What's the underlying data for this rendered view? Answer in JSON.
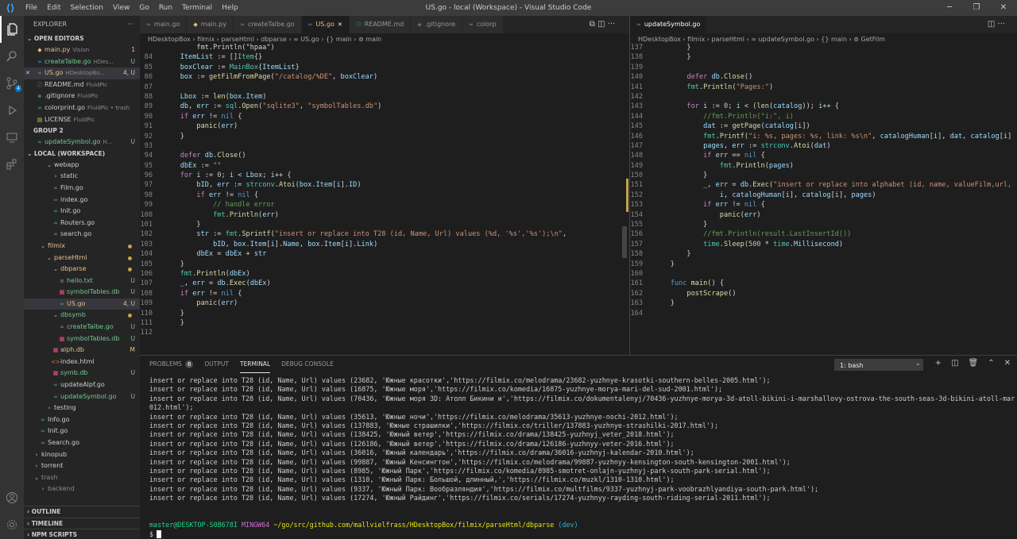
{
  "titlebar": {
    "menu": [
      "File",
      "Edit",
      "Selection",
      "View",
      "Go",
      "Run",
      "Terminal",
      "Help"
    ],
    "title": "US.go - local (Workspace) - Visual Studio Code",
    "win_min": "─",
    "win_max": "❐",
    "win_close": "✕"
  },
  "activity_icons": [
    "files-icon",
    "search-icon",
    "source-control-icon",
    "run-debug-icon",
    "remote-explorer-icon",
    "extensions-icon",
    "account-icon",
    "settings-gear-icon"
  ],
  "sidebar": {
    "header": "EXPLORER",
    "more": "···",
    "open_editors": "OPEN EDITORS",
    "open_editors_items": [
      {
        "icon": "py",
        "name": "main.py",
        "sub": "Vision",
        "badge": "1",
        "color": "#e2c08d"
      },
      {
        "icon": "go",
        "name": "createTalbe.go",
        "sub": "HDes...",
        "badge": "U",
        "color": "#73c991"
      },
      {
        "icon": "go",
        "name": "US.go",
        "sub": "HDesktopBo...",
        "badge": "4, U",
        "color": "#e2c08d",
        "close": "✕",
        "sel": true
      },
      {
        "icon": "md",
        "name": "README.md",
        "sub": "FluidPic",
        "badge": "",
        "color": "#cccccc"
      },
      {
        "icon": "git",
        "name": ".gitignore",
        "sub": "FluidPic",
        "badge": "",
        "color": "#cccccc"
      },
      {
        "icon": "go",
        "name": "colorprint.go",
        "sub": "FluidPic • trash",
        "badge": "",
        "color": "#cccccc"
      },
      {
        "icon": "lic",
        "name": "LICENSE",
        "sub": "FluidPic",
        "badge": "",
        "color": "#cccccc"
      }
    ],
    "group2": "GROUP 2",
    "group2_items": [
      {
        "icon": "go",
        "name": "updateSymbol.go",
        "sub": "H...",
        "badge": "U",
        "color": "#73c991"
      }
    ],
    "workspace": "LOCAL (WORKSPACE)",
    "tree": [
      {
        "indent": 2,
        "arrow": "⌄",
        "name": "webapp",
        "color": "#cccccc",
        "badge": ""
      },
      {
        "indent": 3,
        "arrow": "›",
        "name": "static",
        "color": "#cccccc",
        "badge": ""
      },
      {
        "indent": 3,
        "icon": "go",
        "name": "Film.go",
        "color": "#cccccc",
        "badge": ""
      },
      {
        "indent": 3,
        "icon": "go",
        "name": "index.go",
        "color": "#cccccc",
        "badge": ""
      },
      {
        "indent": 3,
        "icon": "go",
        "name": "Init.go",
        "color": "#cccccc",
        "badge": ""
      },
      {
        "indent": 3,
        "icon": "go",
        "name": "Routers.go",
        "color": "#cccccc",
        "badge": ""
      },
      {
        "indent": 3,
        "icon": "go",
        "name": "search.go",
        "color": "#cccccc",
        "badge": ""
      },
      {
        "indent": 1,
        "arrow": "⌄",
        "name": "filmix",
        "color": "#e2c08d",
        "badge": "dot"
      },
      {
        "indent": 2,
        "arrow": "⌄",
        "name": "parseHtml",
        "color": "#e2c08d",
        "badge": "dot"
      },
      {
        "indent": 3,
        "arrow": "⌄",
        "name": "dbparse",
        "color": "#e2c08d",
        "badge": "dot"
      },
      {
        "indent": 4,
        "icon": "txt",
        "name": "hello.txt",
        "color": "#73c991",
        "badge": "U"
      },
      {
        "indent": 4,
        "icon": "db",
        "name": "symbolTables.db",
        "color": "#73c991",
        "badge": "U"
      },
      {
        "indent": 4,
        "icon": "go",
        "name": "US.go",
        "color": "#e2c08d",
        "badge": "4, U",
        "sel": true
      },
      {
        "indent": 3,
        "arrow": "⌄",
        "name": "dbsymb",
        "color": "#73c991",
        "badge": "dot"
      },
      {
        "indent": 4,
        "icon": "go",
        "name": "createTalbe.go",
        "color": "#73c991",
        "badge": "U"
      },
      {
        "indent": 4,
        "icon": "db",
        "name": "symbolTables.db",
        "color": "#73c991",
        "badge": "U"
      },
      {
        "indent": 3,
        "icon": "db",
        "name": "alph.db",
        "color": "#e2c08d",
        "badge": "M"
      },
      {
        "indent": 3,
        "icon": "html",
        "name": "index.html",
        "color": "#cccccc",
        "badge": ""
      },
      {
        "indent": 3,
        "icon": "db",
        "name": "symb.db",
        "color": "#73c991",
        "badge": "U"
      },
      {
        "indent": 3,
        "icon": "go",
        "name": "updateAlpf.go",
        "color": "#cccccc",
        "badge": ""
      },
      {
        "indent": 3,
        "icon": "go",
        "name": "updateSymbol.go",
        "color": "#73c991",
        "badge": "U"
      },
      {
        "indent": 2,
        "arrow": "›",
        "name": "testing",
        "color": "#cccccc",
        "badge": ""
      },
      {
        "indent": 1,
        "icon": "go",
        "name": "Info.go",
        "color": "#cccccc",
        "badge": ""
      },
      {
        "indent": 1,
        "icon": "go",
        "name": "Init.go",
        "color": "#cccccc",
        "badge": ""
      },
      {
        "indent": 1,
        "icon": "go",
        "name": "Search.go",
        "color": "#cccccc",
        "badge": ""
      },
      {
        "indent": 0,
        "arrow": "›",
        "name": "kinopub",
        "color": "#cccccc",
        "badge": ""
      },
      {
        "indent": 0,
        "arrow": "›",
        "name": "torrent",
        "color": "#cccccc",
        "badge": ""
      },
      {
        "indent": 0,
        "arrow": "⌄",
        "name": "trash",
        "color": "#8b8b8b",
        "badge": ""
      },
      {
        "indent": 1,
        "arrow": "›",
        "name": "backend",
        "color": "#8b8b8b",
        "badge": ""
      }
    ],
    "outline": "OUTLINE",
    "timeline": "TIMELINE",
    "npm": "NPM SCRIPTS"
  },
  "left_tabs": [
    {
      "icon": "go",
      "label": "main.go"
    },
    {
      "icon": "py",
      "label": "main.py"
    },
    {
      "icon": "go",
      "label": "createTalbe.go"
    },
    {
      "icon": "go",
      "label": "US.go",
      "active": true,
      "close": "✕"
    },
    {
      "icon": "md",
      "label": "README.md"
    },
    {
      "icon": "git",
      "label": ".gitignore"
    },
    {
      "icon": "go",
      "label": "colorp"
    }
  ],
  "left_tab_actions": "⧉ ◫ ···",
  "left_breadcrumb": "HDesktopBox  ›  filmix  ›  parseHtml  ›  dbparse  ›  ∞ US.go  ›  {} main  ›  ⊚ main",
  "right_tabs": [
    {
      "icon": "go",
      "label": "updateSymbol.go",
      "active": true
    }
  ],
  "right_tab_actions": "◫ ···",
  "right_breadcrumb": "HDesktopBox  ›  filmix  ›  parseHtml  ›  ∞ updateSymbol.go  ›  {} main  ›  ⊚ GetFilm",
  "left_code": [
    {
      "n": "",
      "h": "<span class='t'>    fmt.Println(\"hpaa\")</span>"
    },
    {
      "n": "84",
      "h": "<span class='v'>ItemList</span> := []<span class='ty'>Item</span>{}"
    },
    {
      "n": "85",
      "h": "<span class='v'>boxClear</span> := <span class='ty'>MainBox</span>{<span class='v'>ItemList</span>}"
    },
    {
      "n": "86",
      "h": "<span class='v'>box</span> := <span class='f'>getFilmFromPage</span>(<span class='s'>\"/catalog/%DE\"</span>, <span class='v'>boxClear</span>)"
    },
    {
      "n": "87",
      "h": ""
    },
    {
      "n": "88",
      "h": "<span class='v'>Lbox</span> := <span class='f'>len</span>(<span class='v'>box</span>.<span class='v'>Item</span>)"
    },
    {
      "n": "89",
      "h": "<span class='v'>db</span>, <span class='v'>err</span> := <span class='ty'>sql</span>.<span class='f'>Open</span>(<span class='s'>\"sqlite3\"</span>, <span class='s'>\"symbolTables.db\"</span>)"
    },
    {
      "n": "90",
      "h": "<span class='k'>if</span> <span class='v'>err</span> != <span class='kw'>nil</span> {"
    },
    {
      "n": "91",
      "h": "    <span class='f'>panic</span>(<span class='v'>err</span>)"
    },
    {
      "n": "92",
      "h": "}"
    },
    {
      "n": "93",
      "h": ""
    },
    {
      "n": "94",
      "h": "<span class='k'>defer</span> <span class='v'>db</span>.<span class='f'>Close</span>()"
    },
    {
      "n": "95",
      "h": "<span class='v'>dbEx</span> := <span class='s'>\"\"</span>"
    },
    {
      "n": "96",
      "h": "<span class='k'>for</span> <span class='v'>i</span> := <span class='nm'>0</span>; <span class='v'>i</span> &lt; <span class='v'>Lbox</span>; <span class='v'>i</span>++ {"
    },
    {
      "n": "97",
      "h": "    <span class='v'>bID</span>, <span class='v'>err</span> := <span class='ty'>strconv</span>.<span class='f'>Atoi</span>(<span class='v'>box</span>.<span class='v'>Item</span>[<span class='v'>i</span>].<span class='v'>ID</span>)"
    },
    {
      "n": "98",
      "h": "    <span class='k'>if</span> <span class='v'>err</span> != <span class='kw'>nil</span> {"
    },
    {
      "n": "99",
      "h": "        <span class='c'>// handle error</span>"
    },
    {
      "n": "100",
      "h": "        <span class='ty'>fmt</span>.<span class='f'>Println</span>(<span class='v'>err</span>)"
    },
    {
      "n": "101",
      "h": "    }"
    },
    {
      "n": "102",
      "h": "    <span class='v'>str</span> := <span class='ty'>fmt</span>.<span class='f'>Sprintf</span>(<span class='s'>\"insert or replace into T28 (id, Name, Url) values (%d, '%s','%s');\\n\"</span>,"
    },
    {
      "n": "103",
      "h": "        <span class='v'>bID</span>, <span class='v'>box</span>.<span class='v'>Item</span>[<span class='v'>i</span>].<span class='v'>Name</span>, <span class='v'>box</span>.<span class='v'>Item</span>[<span class='v'>i</span>].<span class='v'>Link</span>)"
    },
    {
      "n": "104",
      "h": "    <span class='v'>dbEx</span> = <span class='v'>dbEx</span> + <span class='v'>str</span>"
    },
    {
      "n": "105",
      "h": "}"
    },
    {
      "n": "106",
      "h": "<span class='ty'>fmt</span>.<span class='f'>Println</span>(<span class='v'>dbEx</span>)"
    },
    {
      "n": "107",
      "h": "<span class='v'>_</span>, <span class='v'>err</span> = <span class='v'>db</span>.<span class='f'>Exec</span>(<span class='v'>dbEx</span>)"
    },
    {
      "n": "108",
      "h": "<span class='k'>if</span> <span class='v'>err</span> != <span class='kw'>nil</span> {"
    },
    {
      "n": "109",
      "h": "    <span class='f'>panic</span>(<span class='v'>err</span>)"
    },
    {
      "n": "110",
      "h": "}"
    },
    {
      "n": "111",
      "h": "}"
    },
    {
      "n": "112",
      "h": ""
    }
  ],
  "right_code": [
    {
      "n": "137",
      "h": "<span class='t'>    }</span>"
    },
    {
      "n": "138",
      "h": "    }"
    },
    {
      "n": "139",
      "h": ""
    },
    {
      "n": "140",
      "h": "    <span class='k'>defer</span> <span class='v'>db</span>.<span class='f'>Close</span>()"
    },
    {
      "n": "141",
      "h": "    <span class='ty'>fmt</span>.<span class='f'>Println</span>(<span class='s'>\"Pages:\"</span>)"
    },
    {
      "n": "142",
      "h": ""
    },
    {
      "n": "143",
      "h": "    <span class='k'>for</span> <span class='v'>i</span> := <span class='nm'>0</span>; <span class='v'>i</span> &lt; (<span class='f'>len</span>(<span class='v'>catalog</span>)); <span class='v'>i</span>++ {"
    },
    {
      "n": "144",
      "h": "        <span class='c'>//fmt.Println(\"i:\", i)</span>"
    },
    {
      "n": "145",
      "h": "        <span class='v'>dat</span> := <span class='f'>getPage</span>(<span class='v'>catalog</span>[<span class='v'>i</span>])"
    },
    {
      "n": "146",
      "h": "        <span class='ty'>fmt</span>.<span class='f'>Printf</span>(<span class='s'>\"i: %s, pages: %s, link: %s\\n\"</span>, <span class='v'>catalogHuman</span>[<span class='v'>i</span>], <span class='v'>dat</span>, <span class='v'>catalog</span>[<span class='v'>i</span>])"
    },
    {
      "n": "147",
      "h": "        <span class='v'>pages</span>, <span class='v'>err</span> := <span class='ty'>strconv</span>.<span class='f'>Atoi</span>(<span class='v'>dat</span>)"
    },
    {
      "n": "148",
      "h": "        <span class='k'>if</span> <span class='v'>err</span> == <span class='kw'>nil</span> {"
    },
    {
      "n": "149",
      "h": "            <span class='ty'>fmt</span>.<span class='f'>Println</span>(<span class='v'>pages</span>)"
    },
    {
      "n": "150",
      "h": "        }"
    },
    {
      "n": "151",
      "h": "        <span class='v'>_</span>, <span class='v'>err</span> = <span class='v'>db</span>.<span class='f'>Exec</span>(<span class='s'>\"insert or replace into alphabet (id, name, valueFilm,url,page</span>"
    },
    {
      "n": "152",
      "h": "            <span class='v'>i</span>, <span class='v'>catalogHuman</span>[<span class='v'>i</span>], <span class='v'>catalog</span>[<span class='v'>i</span>], <span class='v'>pages</span>)"
    },
    {
      "n": "153",
      "h": "        <span class='k'>if</span> <span class='v'>err</span> != <span class='kw'>nil</span> {"
    },
    {
      "n": "154",
      "h": "            <span class='f'>panic</span>(<span class='v'>err</span>)"
    },
    {
      "n": "155",
      "h": "        }"
    },
    {
      "n": "156",
      "h": "        <span class='c'>//fmt.Println(result.LastInsertId())</span>"
    },
    {
      "n": "157",
      "h": "        <span class='ty'>time</span>.<span class='f'>Sleep</span>(<span class='nm'>500</span> * <span class='ty'>time</span>.<span class='v'>Millisecond</span>)"
    },
    {
      "n": "158",
      "h": "    }"
    },
    {
      "n": "159",
      "h": "}"
    },
    {
      "n": "160",
      "h": ""
    },
    {
      "n": "161",
      "h": "<span class='kw'>func</span> <span class='f'>main</span>() {"
    },
    {
      "n": "162",
      "h": "    <span class='f'>postScrape</span>()"
    },
    {
      "n": "163",
      "h": "}"
    },
    {
      "n": "164",
      "h": ""
    }
  ],
  "panel": {
    "tabs": [
      {
        "label": "PROBLEMS",
        "badge": "6"
      },
      {
        "label": "OUTPUT"
      },
      {
        "label": "TERMINAL",
        "active": true
      },
      {
        "label": "DEBUG CONSOLE"
      }
    ],
    "terminal_select": "1: bash",
    "actions": [
      "+",
      "◫",
      "🗑",
      "⌃",
      "✕"
    ],
    "lines": [
      "insert or replace into T28 (id, Name, Url) values (23682, 'Южные красотки','https://filmix.co/melodrama/23682-yuzhnye-krasotki-southern-belles-2005.html');",
      "insert or replace into T28 (id, Name, Url) values (16875, 'Южные моря','https://filmix.co/komedia/16875-yuzhnye-morya-mari-del-sud-2001.html');",
      "insert or replace into T28 (id, Name, Url) values (70436, 'Южные моря 3D: Атолл Бикини и','https://filmix.co/dokumentalenyj/70436-yuzhnye-morya-3d-atoll-bikini-i-marshallovy-ostrova-the-south-seas-3d-bikini-atoll-marshall-islands-2",
      "012.html');",
      "insert or replace into T28 (id, Name, Url) values (35613, 'Южные ночи','https://filmix.co/melodrama/35613-yuzhnye-nochi-2012.html');",
      "insert or replace into T28 (id, Name, Url) values (137883, 'Южные страшилки','https://filmix.co/triller/137883-yuzhnye-strashilki-2017.html');",
      "insert or replace into T28 (id, Name, Url) values (138425, 'Южный ветер','https://filmix.co/drama/138425-yuzhnyj_veter_2018.html');",
      "insert or replace into T28 (id, Name, Url) values (126186, 'Южный ветер','https://filmix.co/drama/126186-yuzhnyy-veter-2016.html');",
      "insert or replace into T28 (id, Name, Url) values (36016, 'Южный календарь','https://filmix.co/drama/36016-yuzhnyj-kalendar-2010.html');",
      "insert or replace into T28 (id, Name, Url) values (99887, 'Южный Кенсингтон','https://filmix.co/melodrama/99887-yuzhnyy-kensington-south-kensington-2001.html');",
      "insert or replace into T28 (id, Name, Url) values (8985, 'Южный Парк','https://filmix.co/komedia/8985-smotret-onlajn-yuzhnyj-park-south-park-serial.html');",
      "insert or replace into T28 (id, Name, Url) values (1310, 'Южный Парк: Большой, длинный,','https://filmix.co/muzkl/1310-1310.html');",
      "insert or replace into T28 (id, Name, Url) values (9337, 'Южный Парк: Вообразляндия','https://filmix.co/multfilms/9337-yuzhnyj-park-voobrazhlyandiya-south-park.html');",
      "insert or replace into T28 (id, Name, Url) values (17274, 'Южный Райдинг','https://filmix.co/serials/17274-yuzhnyy-rayding-south-riding-serial-2011.html');"
    ],
    "prompt_user": "master@DESKTOP-S0B678I",
    "prompt_env": "MINGW64",
    "prompt_path": "~/go/src/github.com/mallvielfrass/HDesktopBox/filmix/parseHtml/dbparse",
    "prompt_branch": "(dev)",
    "prompt_symbol": "$"
  }
}
